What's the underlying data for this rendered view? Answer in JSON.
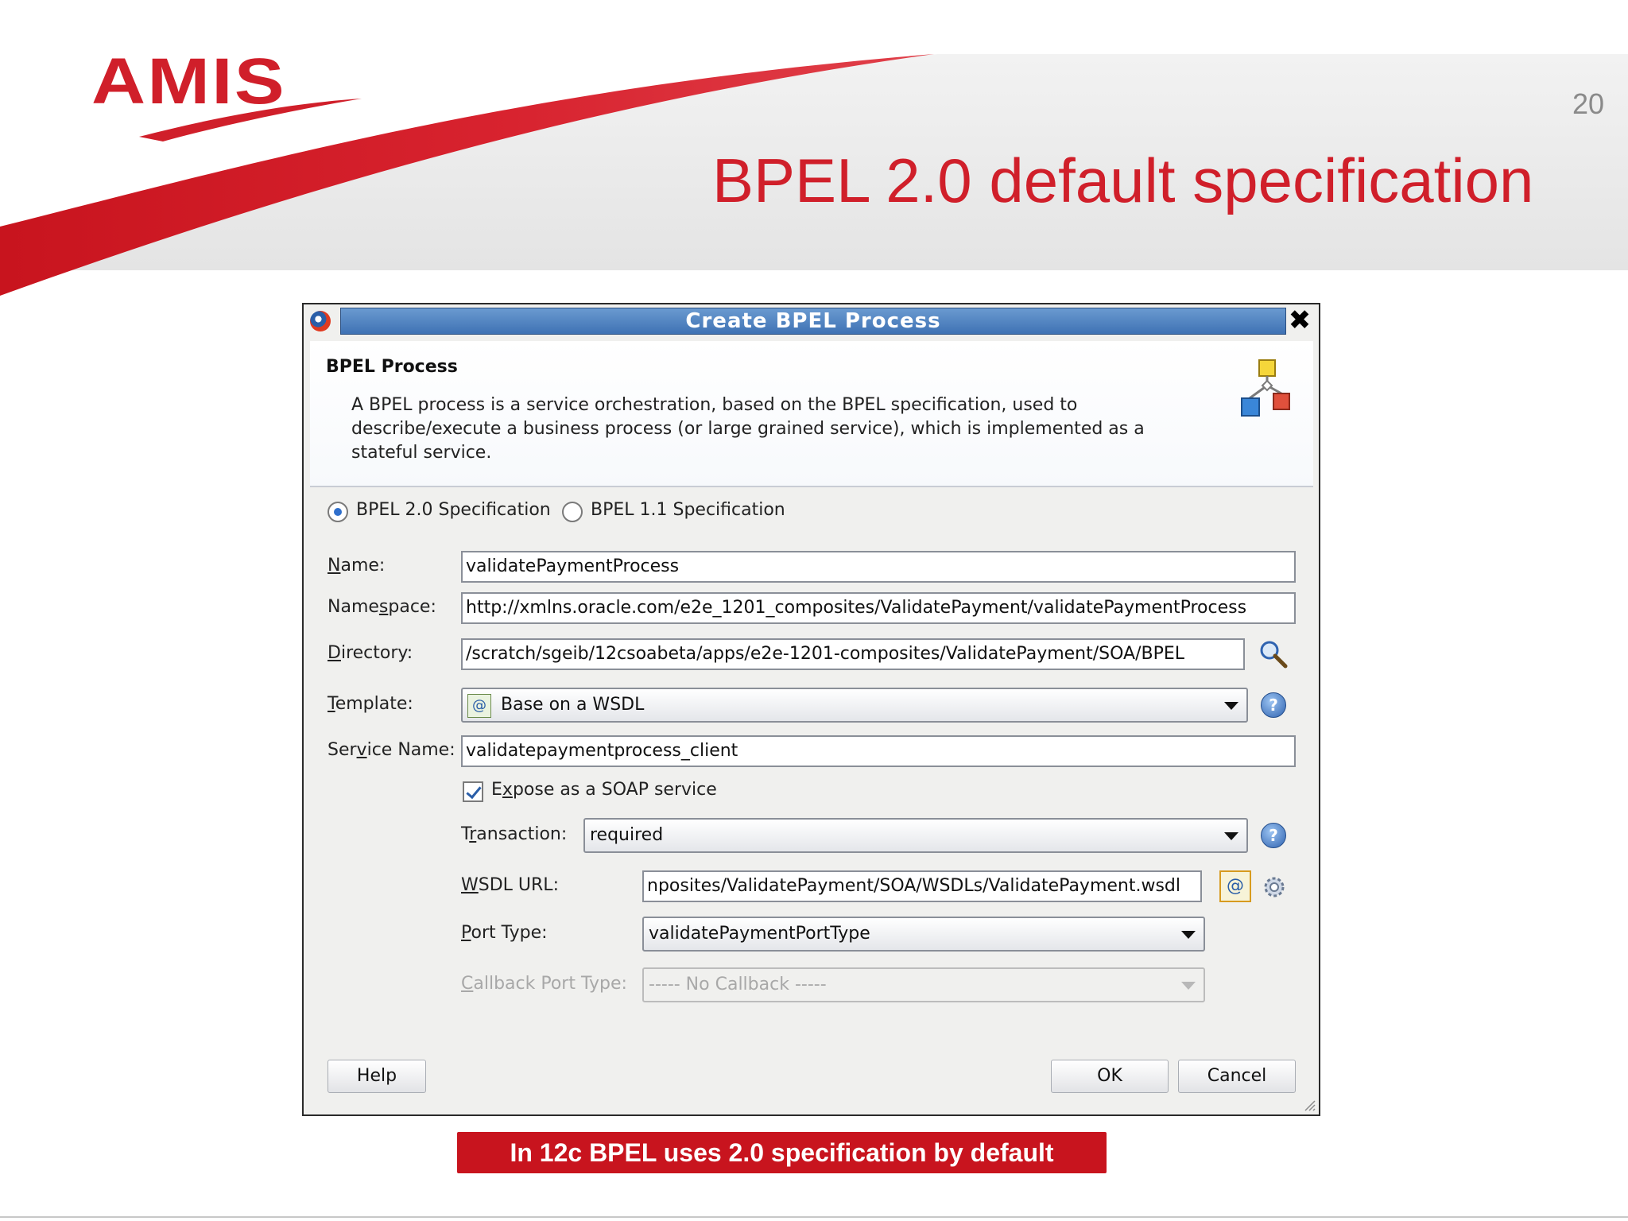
{
  "slide": {
    "logo": "AMIS",
    "page_number": "20",
    "title": "BPEL 2.0 default specification",
    "callout": "In 12c BPEL uses 2.0 specification by default"
  },
  "dialog": {
    "title": "Create BPEL Process",
    "close_icon": "close-icon",
    "heading": "BPEL Process",
    "description": "A BPEL process is a service orchestration, based on the BPEL specification, used to describe/execute a business process (or large grained service), which is implemented as a stateful service.",
    "spec_options": [
      {
        "label": "BPEL 2.0 Specification",
        "selected": true
      },
      {
        "label": "BPEL 1.1 Specification",
        "selected": false
      }
    ],
    "fields": {
      "name": {
        "label_pre": "",
        "label_u": "N",
        "label_post": "ame:",
        "value": "validatePaymentProcess"
      },
      "namespace": {
        "label_pre": "Name",
        "label_u": "s",
        "label_post": "pace:",
        "value": "http://xmlns.oracle.com/e2e_1201_composites/ValidatePayment/validatePaymentProcess"
      },
      "directory": {
        "label_pre": "",
        "label_u": "D",
        "label_post": "irectory:",
        "value": "/scratch/sgeib/12csoabeta/apps/e2e-1201-composites/ValidatePayment/SOA/BPEL"
      },
      "template": {
        "label_pre": "",
        "label_u": "T",
        "label_post": "emplate:",
        "value": "Base on a WSDL"
      },
      "service_name": {
        "label_pre": "Ser",
        "label_u": "v",
        "label_post": "ice Name:",
        "value": "validatepaymentprocess_client"
      }
    },
    "expose_soap": {
      "label_pre": "E",
      "label_u": "x",
      "label_post": "pose as a SOAP service",
      "checked": true
    },
    "transaction": {
      "label_pre": "T",
      "label_u": "r",
      "label_post": "ansaction:",
      "value": "required"
    },
    "wsdl_url": {
      "label_pre": "",
      "label_u": "W",
      "label_post": "SDL URL:",
      "value": "nposites/ValidatePayment/SOA/WSDLs/ValidatePayment.wsdl"
    },
    "port_type": {
      "label_pre": "",
      "label_u": "P",
      "label_post": "ort Type:",
      "value": "validatePaymentPortType"
    },
    "callback_port_type": {
      "label_pre": "",
      "label_u": "C",
      "label_post": "allback Port Type:",
      "value": "----- No Callback -----",
      "disabled": true
    },
    "buttons": {
      "help": "Help",
      "ok": "OK",
      "cancel": "Cancel"
    }
  },
  "colors": {
    "brand_red": "#d01f2a",
    "title_blue": "#3f72b4",
    "callout_red": "#c8141e"
  }
}
